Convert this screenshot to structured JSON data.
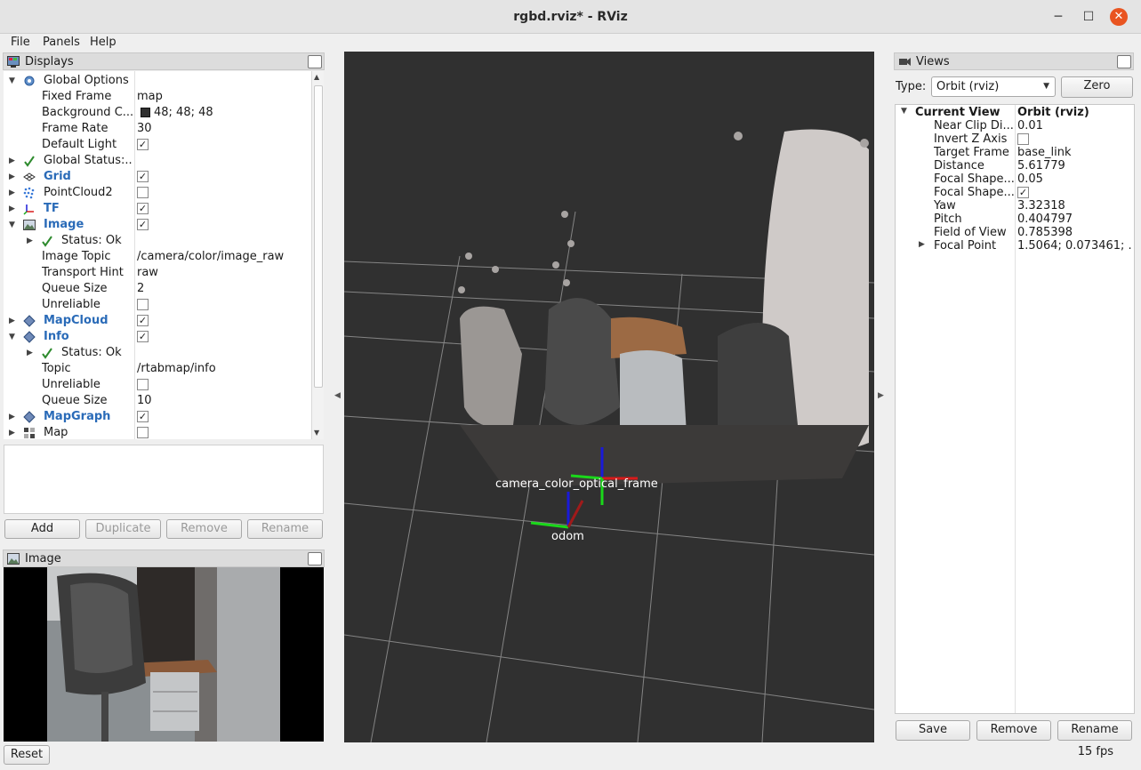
{
  "window": {
    "title": "rgbd.rviz* - RViz"
  },
  "menu": [
    {
      "label": "File"
    },
    {
      "label": "Panels"
    },
    {
      "label": "Help"
    }
  ],
  "displays": {
    "title": "Displays",
    "rows": [
      {
        "label": "Global Options",
        "value": ""
      },
      {
        "label": "Fixed Frame",
        "value": "map"
      },
      {
        "label": "Background C...",
        "value": "48; 48; 48"
      },
      {
        "label": "Frame Rate",
        "value": "30"
      },
      {
        "label": "Default Light",
        "value": ""
      },
      {
        "label": "Global Status:...",
        "value": ""
      },
      {
        "label": "Grid",
        "value": ""
      },
      {
        "label": "PointCloud2",
        "value": ""
      },
      {
        "label": "TF",
        "value": ""
      },
      {
        "label": "Image",
        "value": ""
      },
      {
        "label": "Status: Ok",
        "value": ""
      },
      {
        "label": "Image Topic",
        "value": "/camera/color/image_raw"
      },
      {
        "label": "Transport Hint",
        "value": "raw"
      },
      {
        "label": "Queue Size",
        "value": "2"
      },
      {
        "label": "Unreliable",
        "value": ""
      },
      {
        "label": "MapCloud",
        "value": ""
      },
      {
        "label": "Info",
        "value": ""
      },
      {
        "label": "Status: Ok",
        "value": ""
      },
      {
        "label": "Topic",
        "value": "/rtabmap/info"
      },
      {
        "label": "Unreliable",
        "value": ""
      },
      {
        "label": "Queue Size",
        "value": "10"
      },
      {
        "label": "MapGraph",
        "value": ""
      },
      {
        "label": "Map",
        "value": ""
      }
    ],
    "checkmark": "✓"
  },
  "buttons": {
    "add": "Add",
    "duplicate": "Duplicate",
    "remove": "Remove",
    "rename": "Rename"
  },
  "image_panel": {
    "title": "Image"
  },
  "reset": "Reset",
  "fps": "15 fps",
  "view3d": {
    "labels": {
      "camera_frames": "camera_color_optical_frame",
      "odom_map": "odom"
    }
  },
  "views": {
    "title": "Views",
    "type_label": "Type:",
    "type_value": "Orbit (rviz)",
    "zero": "Zero",
    "rows": [
      {
        "label": "Current View",
        "value": "Orbit (rviz)"
      },
      {
        "label": "Near Clip Di...",
        "value": "0.01"
      },
      {
        "label": "Invert Z Axis",
        "value": ""
      },
      {
        "label": "Target Frame",
        "value": "base_link"
      },
      {
        "label": "Distance",
        "value": "5.61779"
      },
      {
        "label": "Focal Shape...",
        "value": "0.05"
      },
      {
        "label": "Focal Shape...",
        "value": ""
      },
      {
        "label": "Yaw",
        "value": "3.32318"
      },
      {
        "label": "Pitch",
        "value": "0.404797"
      },
      {
        "label": "Field of View",
        "value": "0.785398"
      },
      {
        "label": "Focal Point",
        "value": "1.5064; 0.073461; ..."
      }
    ],
    "save": "Save",
    "remove": "Remove",
    "rename": "Rename"
  },
  "colors": {
    "accent_blue": "#2a6bb8",
    "ok_green": "#2e8b2e",
    "close_orange": "#e95420",
    "bg3d": "#303030"
  }
}
